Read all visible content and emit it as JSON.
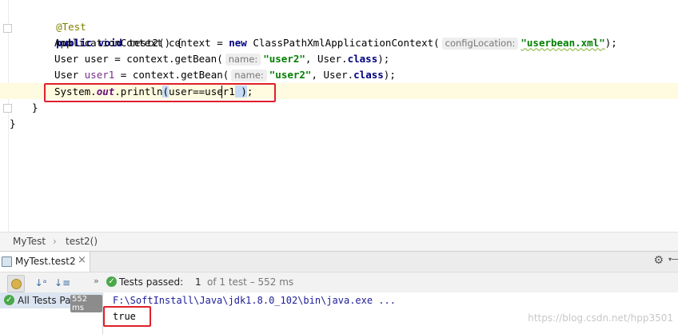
{
  "editor": {
    "lines": {
      "annotation": "@Test",
      "kw_public": "public",
      "kw_void": "void",
      "method_sig": "test2() {",
      "l3_type": "ApplicationContext context = ",
      "kw_new": "new",
      "l3_class": "ClassPathXmlApplicationContext(",
      "l3_hint": "configLocation:",
      "l3_str": "\"userbean.xml\"",
      "l3_end": ");",
      "l4_start": "User user = context.getBean(",
      "l4_hint": "name:",
      "l4_str": "\"user2\"",
      "l4_mid": ", User.",
      "kw_class": "class",
      "l4_end": ");",
      "l5_type": "User ",
      "l5_var": "user1",
      "l5_mid": " = context.getBean(",
      "l5_hint": "name:",
      "l5_str": "\"user2\"",
      "l5_mid2": ", User.",
      "l5_end": ");",
      "l6_system": "System.",
      "l6_out": "out",
      "l6_println": ".println",
      "l6_open": "(",
      "l6_expr": "user==user1",
      "l6_close": " )",
      "l6_end": ";",
      "close_method": "}",
      "close_class": "}"
    }
  },
  "breadcrumb": {
    "class_name": "MyTest",
    "method_name": "test2()"
  },
  "run_panel": {
    "tab_label": "MyTest.test2",
    "status_prefix": "Tests passed:",
    "status_count": "1",
    "status_suffix": "of 1 test – 552 ms",
    "tree_item": "All Tests Pa",
    "tree_time": "552 ms",
    "command": "F:\\SoftInstall\\Java\\jdk1.8.0_102\\bin\\java.exe ...",
    "output": "true"
  },
  "watermark": "https://blog.csdn.net/hpp3501",
  "colors": {
    "highlight_box": "#e0202a",
    "pass_green": "#4aa84a"
  }
}
